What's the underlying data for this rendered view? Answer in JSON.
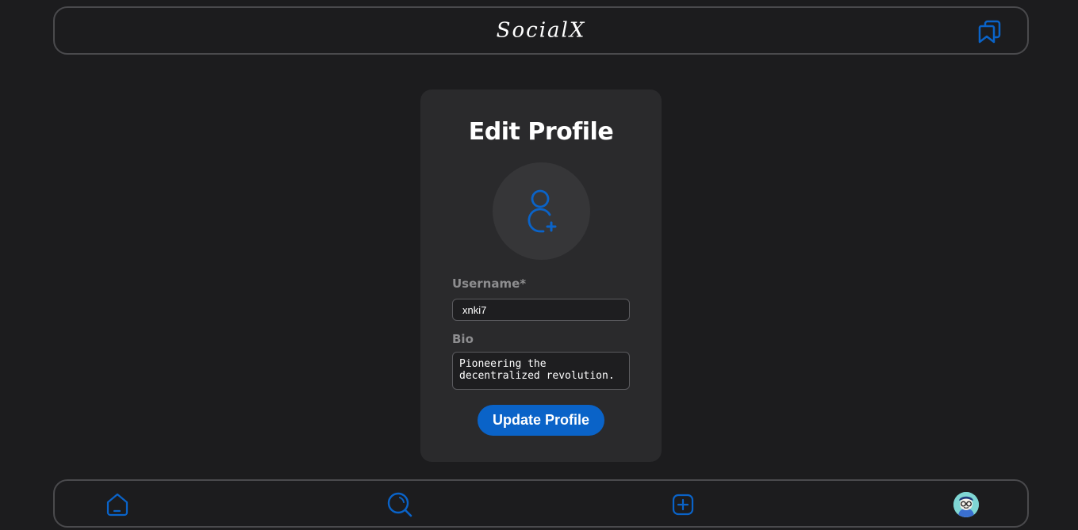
{
  "header": {
    "brand": "SocialX",
    "saved_icon": "bookmark-stack-icon"
  },
  "form": {
    "title": "Edit Profile",
    "avatar_icon": "add-user-icon",
    "username_label": "Username*",
    "username_value": "xnki7",
    "bio_label": "Bio",
    "bio_value": "Pioneering the decentralized revolution.",
    "submit_label": "Update Profile"
  },
  "bottom_nav": {
    "items": [
      {
        "icon": "home-icon"
      },
      {
        "icon": "search-icon"
      },
      {
        "icon": "plus-square-icon"
      },
      {
        "icon": "profile-avatar"
      }
    ]
  },
  "colors": {
    "background": "#1c1c1e",
    "card": "#2a2a2c",
    "accent": "#0a63c8",
    "label": "#8e8e90",
    "border": "#4a4a4d"
  }
}
